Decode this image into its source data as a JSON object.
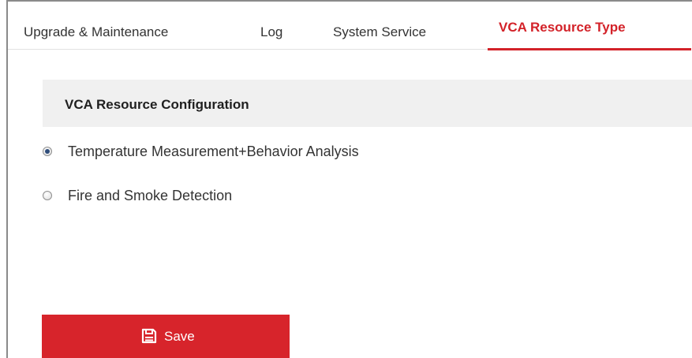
{
  "tabs": [
    {
      "label": "Upgrade & Maintenance",
      "active": false
    },
    {
      "label": "Log",
      "active": false
    },
    {
      "label": "System Service",
      "active": false
    },
    {
      "label": "VCA Resource Type",
      "active": true
    }
  ],
  "section": {
    "title": "VCA Resource Configuration"
  },
  "options": [
    {
      "label": "Temperature Measurement+Behavior Analysis",
      "selected": true
    },
    {
      "label": "Fire and Smoke Detection",
      "selected": false
    }
  ],
  "save_button": {
    "label": "Save",
    "icon": "save-icon",
    "color": "#d7242b"
  },
  "colors": {
    "accent": "#d32229",
    "section_bg": "#f0f0f0"
  }
}
